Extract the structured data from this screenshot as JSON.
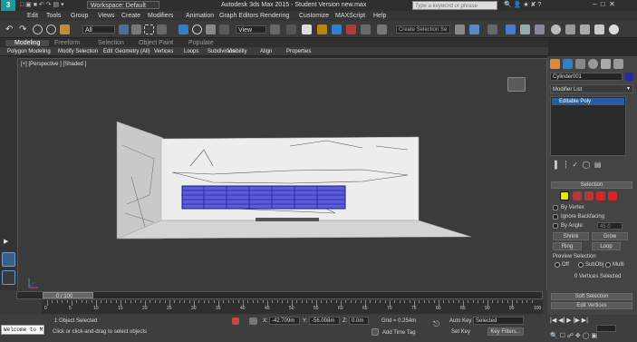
{
  "title": {
    "workspace": "Workspace: Default",
    "app": "Autodesk 3ds Max 2015 - Student Version    new.max",
    "search_placeholder": "Type a keyword or phrase"
  },
  "menu": [
    "Edit",
    "Tools",
    "Group",
    "Views",
    "Create",
    "Modifiers",
    "Animation",
    "Graph Editors",
    "Rendering",
    "Customize",
    "MAXScript",
    "Help"
  ],
  "toolbar": {
    "selection_filter": "All",
    "reference_coord": "View",
    "named_selection": "Create Selection Se"
  },
  "ribbon": {
    "tabs": [
      "Modeling",
      "Freeform",
      "Selection",
      "Object Paint",
      "Populate"
    ],
    "items": [
      "Polygon Modeling",
      "Modify Selection",
      "Edit",
      "Geometry (All)",
      "Vertices",
      "Loops",
      "Subdivision",
      "Visibility",
      "Align",
      "Properties"
    ]
  },
  "viewport": {
    "label": "[+] [Perspective ] [Shaded ]"
  },
  "command_panel": {
    "object_name": "Cylinder001",
    "modifier_list": "Modifier List",
    "stack_item": "Editable Poly",
    "selection_header": "Selection",
    "by_vertex": "By Vertex",
    "ignore_backfacing": "Ignore Backfacing",
    "by_angle": "By Angle:",
    "by_angle_value": "45.0",
    "shrink": "Shrink",
    "grow": "Grow",
    "ring": "Ring",
    "loop": "Loop",
    "preview_selection": "Preview Selection",
    "preview_off": "Off",
    "preview_subobj": "SubObj",
    "preview_multi": "Multi",
    "vertices_selected": "0 Vertices Selected",
    "soft_selection": "Soft Selection",
    "edit_vertices": "Edit Vertices"
  },
  "timeline": {
    "frame": "0 / 100",
    "ticks": [
      "0",
      "5",
      "10",
      "15",
      "20",
      "25",
      "30",
      "35",
      "40",
      "45",
      "50",
      "55",
      "60",
      "65",
      "70",
      "75",
      "80",
      "85",
      "90",
      "95",
      "100"
    ]
  },
  "status": {
    "maxscript": "Welcome to M",
    "objects_selected": "1 Object Selected",
    "prompt": "Click or click-and-drag to select objects",
    "x_label": "X:",
    "x_value": "-42.709m",
    "y_label": "Y:",
    "y_value": "-56.008m",
    "z_label": "Z:",
    "z_value": "0.0m",
    "grid": "Grid = 0.254m",
    "add_time_tag": "Add Time Tag",
    "auto_key": "Auto Key",
    "key_mode": "Selected",
    "set_key": "Set Key",
    "key_filters": "Key Filters..."
  }
}
